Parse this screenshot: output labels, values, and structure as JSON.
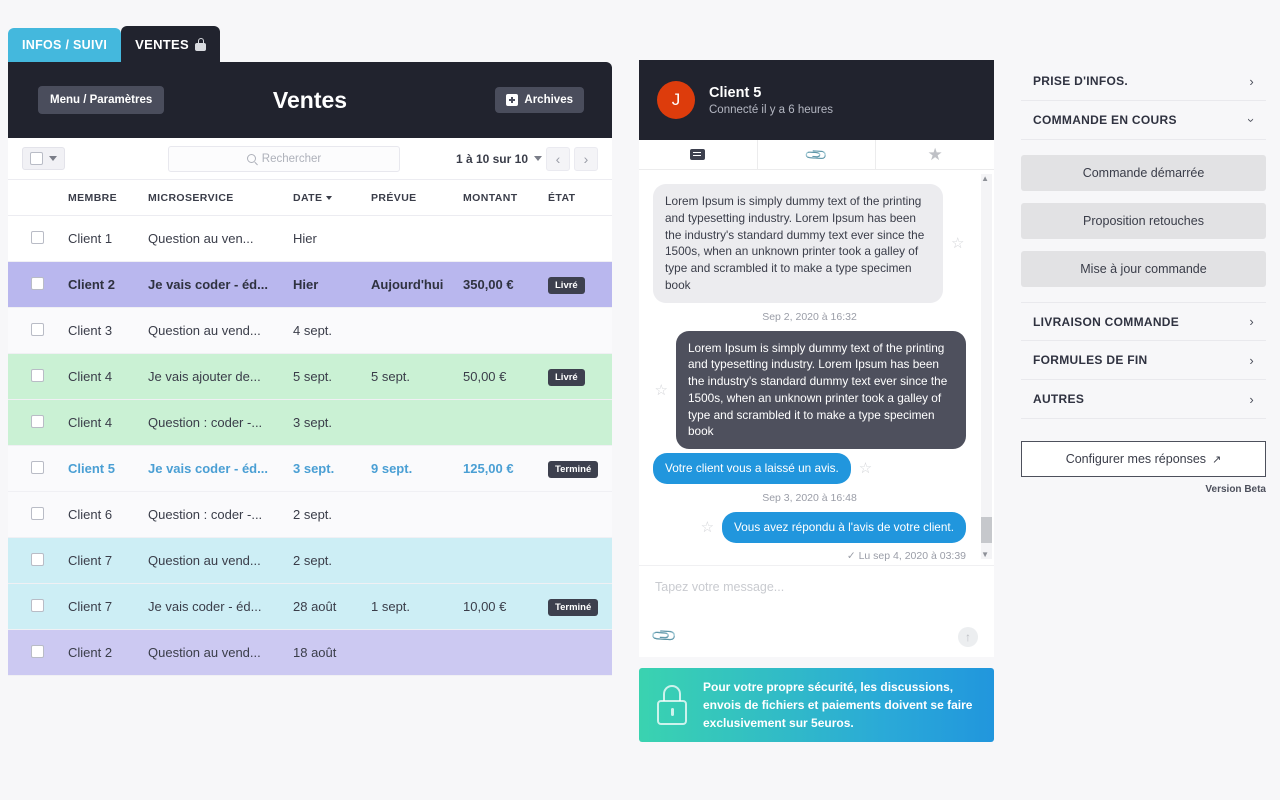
{
  "tabs": [
    {
      "label": "INFOS / SUIVI",
      "active": false
    },
    {
      "label": "VENTES",
      "active": true,
      "icon": "lock-icon"
    }
  ],
  "left_panel": {
    "menu_button": "Menu / Paramètres",
    "title": "Ventes",
    "archives_button": "Archives",
    "toolbar": {
      "search_placeholder": "Rechercher",
      "pagination_label": "1 à 10 sur 10",
      "prev_icon": "‹",
      "next_icon": "›"
    },
    "table": {
      "columns": [
        "",
        "MEMBRE",
        "MICROSERVICE",
        "DATE",
        "PRÉVUE",
        "MONTANT",
        "ÉTAT"
      ],
      "sorted_column": "DATE",
      "rows": [
        {
          "member": "Client 1",
          "microservice": "Question au ven...",
          "date": "Hier",
          "prevue": "",
          "montant": "",
          "etat": "",
          "style": "r-normal"
        },
        {
          "member": "Client 2",
          "microservice": "Je vais coder - éd...",
          "date": "Hier",
          "prevue": "Aujourd'hui",
          "montant": "350,00 €",
          "etat": "Livré",
          "style": "r-purple"
        },
        {
          "member": "Client 3",
          "microservice": "Question au vend...",
          "date": "4 sept.",
          "prevue": "",
          "montant": "",
          "etat": "",
          "style": "r-alt"
        },
        {
          "member": "Client 4",
          "microservice": "Je vais ajouter de...",
          "date": "5 sept.",
          "prevue": "5 sept.",
          "montant": "50,00 €",
          "etat": "Livré",
          "style": "r-green"
        },
        {
          "member": "Client 4",
          "microservice": "Question : coder -...",
          "date": "3 sept.",
          "prevue": "",
          "montant": "",
          "etat": "",
          "style": "r-green"
        },
        {
          "member": "Client 5",
          "microservice": "Je vais coder - éd...",
          "date": "3 sept.",
          "prevue": "9 sept.",
          "montant": "125,00 €",
          "etat": "Terminé",
          "style": "r-alt r-sel"
        },
        {
          "member": "Client 6",
          "microservice": "Question : coder -...",
          "date": "2 sept.",
          "prevue": "",
          "montant": "",
          "etat": "",
          "style": "r-alt"
        },
        {
          "member": "Client 7",
          "microservice": "Question au vend...",
          "date": "2 sept.",
          "prevue": "",
          "montant": "",
          "etat": "",
          "style": "r-cyan"
        },
        {
          "member": "Client 7",
          "microservice": "Je vais coder - éd...",
          "date": "28 août",
          "prevue": "1 sept.",
          "montant": "10,00 €",
          "etat": "Terminé",
          "style": "r-cyan"
        },
        {
          "member": "Client 2",
          "microservice": "Question au vend...",
          "date": "18 août",
          "prevue": "",
          "montant": "",
          "etat": "",
          "style": "r-lav"
        }
      ]
    }
  },
  "chat": {
    "avatar_initial": "J",
    "name": "Client 5",
    "status": "Connecté il y a 6 heures",
    "tabs": [
      "message-icon",
      "attachment-icon",
      "star-icon"
    ],
    "messages": [
      {
        "side": "left",
        "type": "grey",
        "text": "Lorem Ipsum is simply dummy text of the printing and typesetting industry. Lorem Ipsum has been the industry's standard dummy text ever since the 1500s, when an unknown printer took a galley of type and scrambled it to make a type specimen book"
      },
      {
        "side": "center",
        "type": "timestamp",
        "text": "Sep 2, 2020 à 16:32"
      },
      {
        "side": "right",
        "type": "dark",
        "text": "Lorem Ipsum is simply dummy text of the printing and typesetting industry. Lorem Ipsum has been the industry's standard dummy text ever since the 1500s, when an unknown printer took a galley of type and scrambled it to make a type specimen book"
      },
      {
        "side": "left",
        "type": "blue",
        "text": "Votre client vous a laissé un avis."
      },
      {
        "side": "center",
        "type": "timestamp",
        "text": "Sep 3, 2020 à 16:48"
      },
      {
        "side": "right",
        "type": "blue",
        "text": "Vous avez répondu à l'avis de votre client."
      },
      {
        "side": "right",
        "type": "read-receipt",
        "text": "✓ Lu sep 4, 2020 à 03:39"
      }
    ],
    "composer_placeholder": "Tapez votre message...",
    "attach_icon": "paperclip-icon",
    "send_icon": "↑",
    "security_banner": "Pour votre propre sécurité, les discussions, envois de fichiers et paiements doivent se faire exclusivement sur 5euros."
  },
  "sidebar": {
    "sections": [
      {
        "label": "PRISE D'INFOS.",
        "expanded": false
      },
      {
        "label": "COMMANDE EN COURS",
        "expanded": true
      }
    ],
    "order_buttons": [
      "Commande démarrée",
      "Proposition retouches",
      "Mise à jour commande"
    ],
    "more_sections": [
      {
        "label": "LIVRAISON COMMANDE",
        "expanded": false
      },
      {
        "label": "FORMULES DE FIN",
        "expanded": false
      },
      {
        "label": "AUTRES",
        "expanded": false
      }
    ],
    "configure_button": "Configurer mes réponses",
    "version": "Version Beta"
  },
  "colors": {
    "tab_active_bg": "#21232e",
    "tab_infos_bg": "#44b8dd",
    "accent_blue": "#2196dd",
    "avatar": "#dd3c0c",
    "row_purple": "#b9b7ee",
    "row_green": "#caf1d4",
    "row_cyan": "#cdeef5",
    "row_lavender": "#ccc9f2",
    "badge_bg": "#3d404e"
  }
}
